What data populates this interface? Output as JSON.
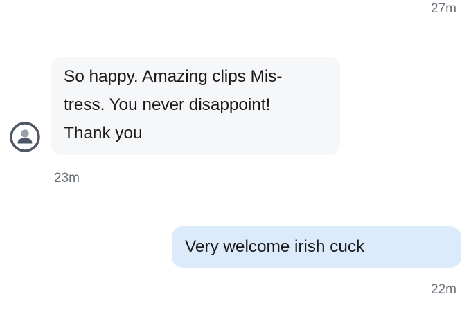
{
  "thread": {
    "top_timestamp": "27m",
    "incoming": {
      "lines": [
        "So happy. Amazing clips Mis-",
        "tress. You never disappoint!",
        "Thank you"
      ],
      "timestamp": "23m",
      "avatar_icon": "default-user-avatar-icon"
    },
    "outgoing": {
      "text": "Very welcome irish cuck",
      "timestamp": "22m"
    }
  },
  "colors": {
    "incoming_bubble": "#f6f7f9",
    "outgoing_bubble": "#dcebfb",
    "timestamp": "#6b7079",
    "avatar": "#4d5665"
  }
}
